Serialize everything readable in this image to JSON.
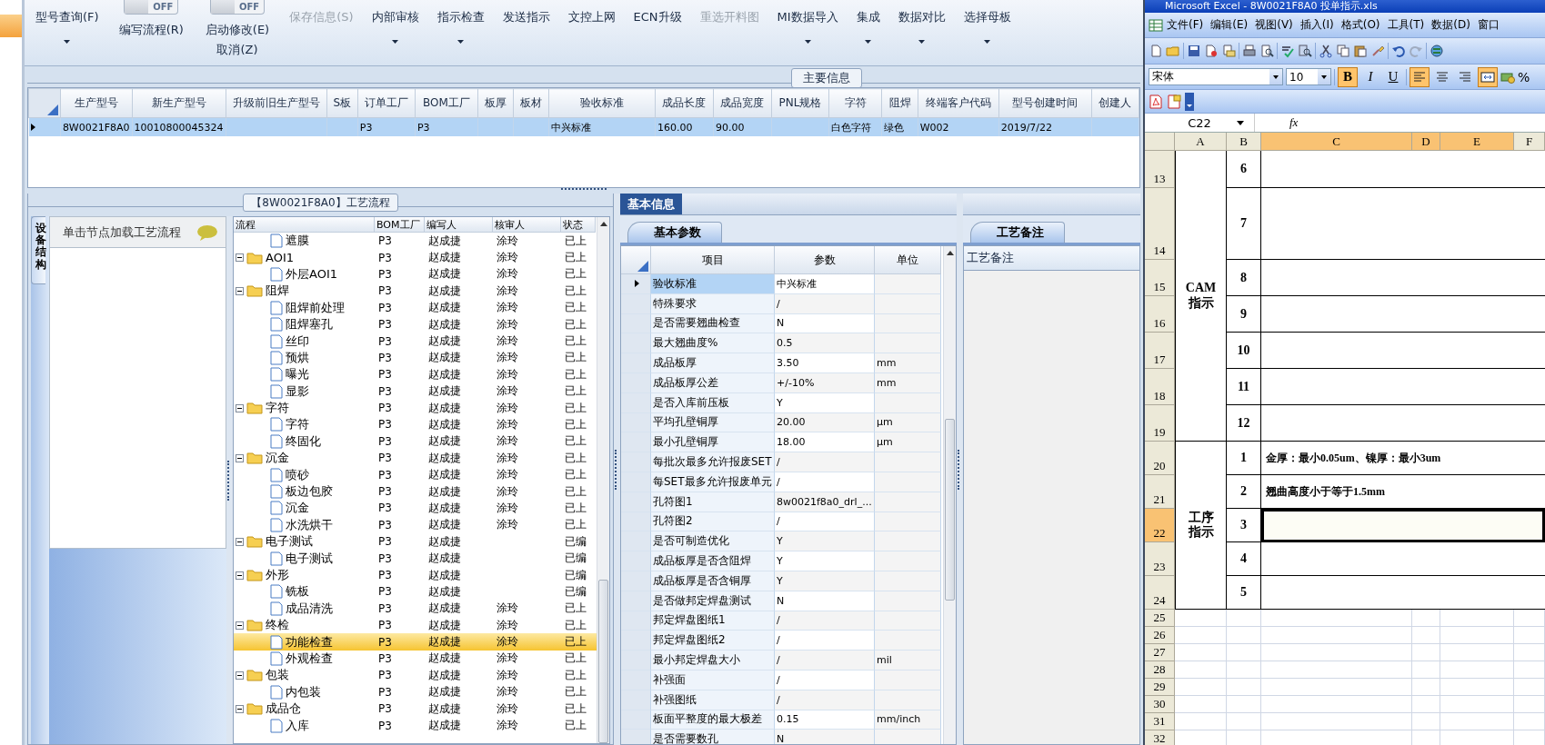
{
  "toolbar": {
    "items": [
      {
        "kind": "button",
        "label": "型号查询(F)",
        "dropdown": true,
        "disabled": false
      },
      {
        "kind": "toggle",
        "label": "编写流程(R)",
        "switch_text": "OFF",
        "on": false
      },
      {
        "kind": "toggle",
        "label": "启动修改(E)",
        "sublabel": "取消(Z)",
        "switch_text": "OFF",
        "on": false
      },
      {
        "kind": "button",
        "label": "保存信息(S)",
        "dropdown": false,
        "disabled": true
      },
      {
        "kind": "button",
        "label": "内部审核",
        "dropdown": true,
        "disabled": false
      },
      {
        "kind": "button",
        "label": "指示检查",
        "dropdown": true,
        "disabled": false
      },
      {
        "kind": "button",
        "label": "发送指示",
        "dropdown": false,
        "disabled": false
      },
      {
        "kind": "button",
        "label": "文控上网",
        "dropdown": false,
        "disabled": false
      },
      {
        "kind": "button",
        "label": "ECN升级",
        "dropdown": false,
        "disabled": false
      },
      {
        "kind": "button",
        "label": "重选开料图",
        "dropdown": false,
        "disabled": true
      },
      {
        "kind": "button",
        "label": "MI数据导入",
        "dropdown": true,
        "disabled": false
      },
      {
        "kind": "button",
        "label": "集成",
        "dropdown": true,
        "disabled": false
      },
      {
        "kind": "button",
        "label": "数据对比",
        "dropdown": true,
        "disabled": false
      },
      {
        "kind": "button",
        "label": "选择母板",
        "dropdown": true,
        "disabled": false
      }
    ]
  },
  "main_info": {
    "title": "主要信息",
    "columns": [
      "生产型号",
      "新生产型号",
      "升级前旧生产型号",
      "S板",
      "订单工厂",
      "BOM工厂",
      "板厚",
      "板材",
      "验收标准",
      "成品长度",
      "成品宽度",
      "PNL规格",
      "字符",
      "阻焊",
      "终端客户代码",
      "型号创建时间",
      "创建人"
    ],
    "rows": [
      {
        "selected": true,
        "cells": [
          "8W0021F8A0",
          "10010800045324",
          null,
          null,
          "P3",
          "P3",
          null,
          null,
          "中兴标准",
          "160.00",
          "90.00",
          null,
          "白色字符",
          "绿色",
          "W002",
          "2019/7/22",
          null
        ]
      }
    ]
  },
  "process": {
    "title": "【8W0021F8A0】工艺流程",
    "side_tab": "设备结构",
    "side_header": "单击节点加载工艺流程",
    "columns": [
      "流程",
      "BOM工厂",
      "编写人",
      "核审人",
      "状态"
    ],
    "nodes": [
      {
        "kind": "file",
        "label": "遮膜",
        "bom": "P3",
        "writer": "赵成捷",
        "reviewer": "涂玲",
        "status": "已上",
        "selected": false
      },
      {
        "kind": "folder",
        "label": "AOI1",
        "bom": "P3",
        "writer": "赵成捷",
        "reviewer": "涂玲",
        "status": "已上",
        "selected": false,
        "children": [
          {
            "kind": "file",
            "label": "外层AOI1",
            "bom": "P3",
            "writer": "赵成捷",
            "reviewer": "涂玲",
            "status": "已上",
            "selected": false
          }
        ]
      },
      {
        "kind": "folder",
        "label": "阻焊",
        "bom": "P3",
        "writer": "赵成捷",
        "reviewer": "涂玲",
        "status": "已上",
        "selected": false,
        "children": [
          {
            "kind": "file",
            "label": "阻焊前处理",
            "bom": "P3",
            "writer": "赵成捷",
            "reviewer": "涂玲",
            "status": "已上",
            "selected": false
          },
          {
            "kind": "file",
            "label": "阻焊塞孔",
            "bom": "P3",
            "writer": "赵成捷",
            "reviewer": "涂玲",
            "status": "已上",
            "selected": false
          },
          {
            "kind": "file",
            "label": "丝印",
            "bom": "P3",
            "writer": "赵成捷",
            "reviewer": "涂玲",
            "status": "已上",
            "selected": false
          },
          {
            "kind": "file",
            "label": "预烘",
            "bom": "P3",
            "writer": "赵成捷",
            "reviewer": "涂玲",
            "status": "已上",
            "selected": false
          },
          {
            "kind": "file",
            "label": "曝光",
            "bom": "P3",
            "writer": "赵成捷",
            "reviewer": "涂玲",
            "status": "已上",
            "selected": false
          },
          {
            "kind": "file",
            "label": "显影",
            "bom": "P3",
            "writer": "赵成捷",
            "reviewer": "涂玲",
            "status": "已上",
            "selected": false
          }
        ]
      },
      {
        "kind": "folder",
        "label": "字符",
        "bom": "P3",
        "writer": "赵成捷",
        "reviewer": "涂玲",
        "status": "已上",
        "selected": false,
        "children": [
          {
            "kind": "file",
            "label": "字符",
            "bom": "P3",
            "writer": "赵成捷",
            "reviewer": "涂玲",
            "status": "已上",
            "selected": false
          },
          {
            "kind": "file",
            "label": "终固化",
            "bom": "P3",
            "writer": "赵成捷",
            "reviewer": "涂玲",
            "status": "已上",
            "selected": false
          }
        ]
      },
      {
        "kind": "folder",
        "label": "沉金",
        "bom": "P3",
        "writer": "赵成捷",
        "reviewer": "涂玲",
        "status": "已上",
        "selected": false,
        "children": [
          {
            "kind": "file",
            "label": "喷砂",
            "bom": "P3",
            "writer": "赵成捷",
            "reviewer": "涂玲",
            "status": "已上",
            "selected": false
          },
          {
            "kind": "file",
            "label": "板边包胶",
            "bom": "P3",
            "writer": "赵成捷",
            "reviewer": "涂玲",
            "status": "已上",
            "selected": false
          },
          {
            "kind": "file",
            "label": "沉金",
            "bom": "P3",
            "writer": "赵成捷",
            "reviewer": "涂玲",
            "status": "已上",
            "selected": false
          },
          {
            "kind": "file",
            "label": "水洗烘干",
            "bom": "P3",
            "writer": "赵成捷",
            "reviewer": "涂玲",
            "status": "已上",
            "selected": false
          }
        ]
      },
      {
        "kind": "folder",
        "label": "电子测试",
        "bom": "P3",
        "writer": "赵成捷",
        "status": "已编",
        "selected": false,
        "children": [
          {
            "kind": "file",
            "label": "电子测试",
            "bom": "P3",
            "writer": "赵成捷",
            "status": "已编",
            "selected": false
          }
        ]
      },
      {
        "kind": "folder",
        "label": "外形",
        "bom": "P3",
        "writer": "赵成捷",
        "status": "已编",
        "selected": false,
        "children": [
          {
            "kind": "file",
            "label": "铣板",
            "bom": "P3",
            "writer": "赵成捷",
            "status": "已编",
            "selected": false
          },
          {
            "kind": "file",
            "label": "成品清洗",
            "bom": "P3",
            "writer": "赵成捷",
            "reviewer": "涂玲",
            "status": "已上",
            "selected": false
          }
        ]
      },
      {
        "kind": "folder",
        "label": "终检",
        "bom": "P3",
        "writer": "赵成捷",
        "reviewer": "涂玲",
        "status": "已上",
        "selected": false,
        "children": [
          {
            "kind": "file",
            "label": "功能检查",
            "bom": "P3",
            "writer": "赵成捷",
            "reviewer": "涂玲",
            "status": "已上",
            "selected": true
          },
          {
            "kind": "file",
            "label": "外观检查",
            "bom": "P3",
            "writer": "赵成捷",
            "reviewer": "涂玲",
            "status": "已上",
            "selected": false
          }
        ]
      },
      {
        "kind": "folder",
        "label": "包装",
        "bom": "P3",
        "writer": "赵成捷",
        "reviewer": "涂玲",
        "status": "已上",
        "selected": false,
        "children": [
          {
            "kind": "file",
            "label": "内包装",
            "bom": "P3",
            "writer": "赵成捷",
            "reviewer": "涂玲",
            "status": "已上",
            "selected": false
          }
        ]
      },
      {
        "kind": "folder",
        "label": "成品仓",
        "bom": "P3",
        "writer": "赵成捷",
        "reviewer": "涂玲",
        "status": "已上",
        "selected": false,
        "children": [
          {
            "kind": "file",
            "label": "入库",
            "bom": "P3",
            "writer": "赵成捷",
            "reviewer": "涂玲",
            "status": "已上",
            "selected": false
          }
        ]
      }
    ]
  },
  "basic_info": {
    "tab": "基本信息",
    "subtab": "基本参数",
    "columns": [
      "项目",
      "参数",
      "单位"
    ],
    "rows": [
      {
        "item": "验收标准",
        "value": "中兴标准",
        "selected": true
      },
      {
        "item": "特殊要求",
        "value": "/",
        "selected": false
      },
      {
        "item": "是否需要翘曲检查",
        "value": "N",
        "selected": false
      },
      {
        "item": "最大翘曲度%",
        "value": "0.5",
        "selected": false
      },
      {
        "item": "成品板厚",
        "value": "3.50",
        "unit": "mm",
        "selected": false
      },
      {
        "item": "成品板厚公差",
        "value": "+/-10%",
        "unit": "mm",
        "selected": false
      },
      {
        "item": "是否入库前压板",
        "value": "Y",
        "selected": false
      },
      {
        "item": "平均孔壁铜厚",
        "value": "20.00",
        "unit": "μm",
        "selected": false
      },
      {
        "item": "最小孔壁铜厚",
        "value": "18.00",
        "unit": "μm",
        "selected": false
      },
      {
        "item": "每批次最多允许报废SET",
        "value": "/",
        "selected": false
      },
      {
        "item": "每SET最多允许报废单元",
        "value": "/",
        "selected": false
      },
      {
        "item": "孔符图1",
        "value": "8w0021f8a0_drl_...",
        "selected": false
      },
      {
        "item": "孔符图2",
        "value": "/",
        "selected": false
      },
      {
        "item": "是否可制造优化",
        "value": "Y",
        "selected": false
      },
      {
        "item": "成品板厚是否含阻焊",
        "value": "Y",
        "selected": false
      },
      {
        "item": "成品板厚是否含铜厚",
        "value": "Y",
        "selected": false
      },
      {
        "item": "是否做邦定焊盘测试",
        "value": "N",
        "selected": false
      },
      {
        "item": "邦定焊盘图纸1",
        "value": "/",
        "selected": false
      },
      {
        "item": "邦定焊盘图纸2",
        "value": "/",
        "selected": false
      },
      {
        "item": "最小邦定焊盘大小",
        "value": "/",
        "unit": "mil",
        "selected": false
      },
      {
        "item": "补强面",
        "value": "/",
        "selected": false
      },
      {
        "item": "补强图纸",
        "value": "/",
        "selected": false
      },
      {
        "item": "板面平整度的最大极差",
        "value": "0.15",
        "unit": "mm/inch",
        "selected": false
      },
      {
        "item": "是否需要数孔",
        "value": "N",
        "selected": false
      }
    ]
  },
  "remarks": {
    "tab": "工艺备注",
    "header": "工艺备注"
  },
  "excel": {
    "title": "Microsoft Excel - 8W0021F8A0 投单指示.xls",
    "menu": [
      "文件(F)",
      "编辑(E)",
      "视图(V)",
      "插入(I)",
      "格式(O)",
      "工具(T)",
      "数据(D)",
      "窗口"
    ],
    "font": "宋体",
    "font_size": "10",
    "format_buttons": [
      {
        "label": "B",
        "pressed": true
      },
      {
        "label": "I",
        "pressed": false
      },
      {
        "label": "U",
        "pressed": false
      }
    ],
    "align_buttons": [
      {
        "kind": "left",
        "selected": true
      },
      {
        "kind": "center",
        "selected": false
      },
      {
        "kind": "right",
        "selected": false
      },
      {
        "kind": "merge",
        "selected": true
      }
    ],
    "percent": "%",
    "name_box": "C22",
    "formula_label": "fx",
    "columns": [
      {
        "label": "A",
        "selected": false
      },
      {
        "label": "B",
        "selected": false
      },
      {
        "label": "C",
        "selected": true
      },
      {
        "label": "D",
        "selected": true
      },
      {
        "label": "E",
        "selected": true
      },
      {
        "label": "F",
        "selected": false
      }
    ],
    "rows": [
      {
        "label": "13",
        "selected": false
      },
      {
        "label": "14",
        "selected": false
      },
      {
        "label": "15",
        "selected": false
      },
      {
        "label": "16",
        "selected": false
      },
      {
        "label": "17",
        "selected": false
      },
      {
        "label": "18",
        "selected": false
      },
      {
        "label": "19",
        "selected": false
      },
      {
        "label": "20",
        "selected": false
      },
      {
        "label": "21",
        "selected": false
      },
      {
        "label": "22",
        "selected": true
      },
      {
        "label": "23",
        "selected": false
      },
      {
        "label": "24",
        "selected": false
      },
      {
        "label": "25",
        "selected": false
      },
      {
        "label": "26",
        "selected": false
      },
      {
        "label": "27",
        "selected": false
      },
      {
        "label": "28",
        "selected": false
      },
      {
        "label": "29",
        "selected": false
      },
      {
        "label": "30",
        "selected": false
      },
      {
        "label": "31",
        "selected": false
      },
      {
        "label": "32",
        "selected": false
      }
    ],
    "blocks": [
      {
        "title_lines": [
          "CAM",
          "指示"
        ],
        "items": [
          {
            "number": "6",
            "selected": false
          },
          {
            "number": "7",
            "selected": false
          },
          {
            "number": "8",
            "selected": false
          },
          {
            "number": "9",
            "selected": false
          },
          {
            "number": "10",
            "selected": false
          },
          {
            "number": "11",
            "selected": false
          },
          {
            "number": "12",
            "selected": false
          }
        ]
      },
      {
        "title_lines": [
          "工序",
          "指示"
        ],
        "items": [
          {
            "number": "1",
            "text": "金厚：最小0.05um、镍厚：最小3um",
            "selected": false
          },
          {
            "number": "2",
            "text": "翘曲高度小于等于1.5mm",
            "selected": false
          },
          {
            "number": "3",
            "selected": true
          },
          {
            "number": "4",
            "selected": false
          },
          {
            "number": "5",
            "selected": false
          }
        ]
      }
    ]
  }
}
